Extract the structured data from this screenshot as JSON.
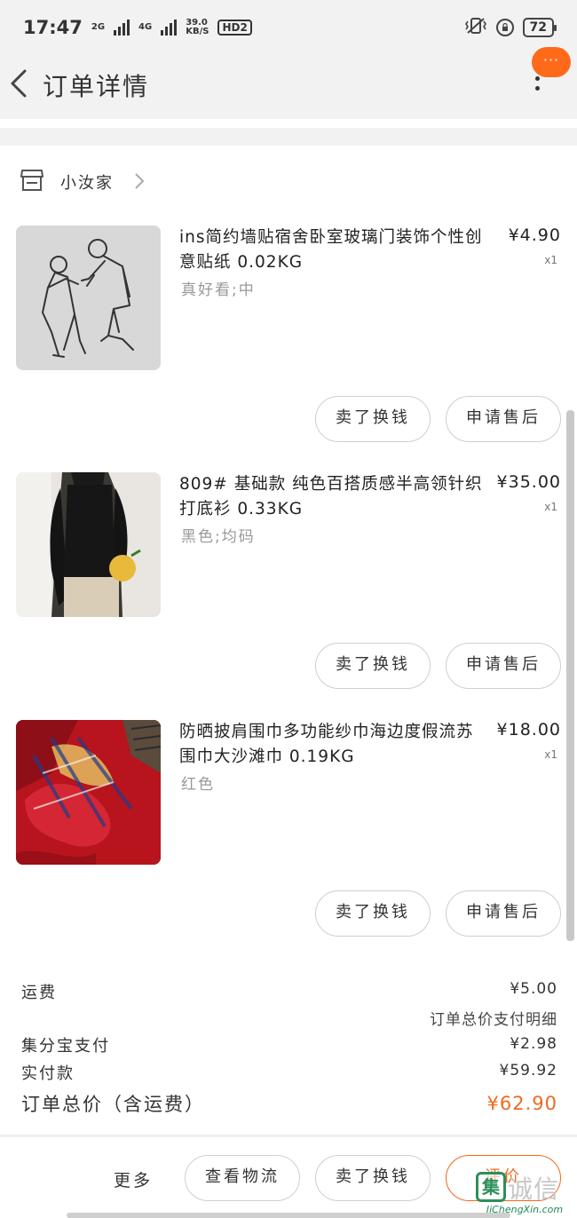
{
  "status_bar": {
    "time": "17:47",
    "net_2g": "2G",
    "net_4g": "4G",
    "speed_value": "39.0",
    "speed_unit": "KB/S",
    "hd": "HD2",
    "battery": "72"
  },
  "header": {
    "title": "订单详情",
    "chat_badge": "···"
  },
  "shop": {
    "name": "小汝家"
  },
  "products": [
    {
      "title": "ins简约墙贴宿舍卧室玻璃门装饰个性创意贴纸 0.02KG",
      "variant": "真好看;中",
      "price": "¥4.90",
      "qty": "x1",
      "btn_sell": "卖了换钱",
      "btn_aftersale": "申请售后"
    },
    {
      "title": "809# 基础款 纯色百搭质感半高领针织打底衫 0.33KG",
      "variant": "黑色;均码",
      "price": "¥35.00",
      "qty": "x1",
      "btn_sell": "卖了换钱",
      "btn_aftersale": "申请售后"
    },
    {
      "title": "防晒披肩围巾多功能纱巾海边度假流苏围巾大沙滩巾 0.19KG",
      "variant": "红色",
      "price": "¥18.00",
      "qty": "x1",
      "btn_sell": "卖了换钱",
      "btn_aftersale": "申请售后"
    }
  ],
  "summary": {
    "shipping_label": "运费",
    "shipping_value": "¥5.00",
    "payment_detail_link": "订单总价支付明细",
    "points_label": "集分宝支付",
    "points_value": "¥2.98",
    "paid_label": "实付款",
    "paid_value": "¥59.92",
    "total_label": "订单总价（含运费）",
    "total_value": "¥62.90"
  },
  "bottom_bar": {
    "more": "更多",
    "logistics": "查看物流",
    "sell": "卖了换钱",
    "review": "评价"
  },
  "watermark": {
    "mark": "集",
    "text": "诚信",
    "site": "JiChengXin.com"
  },
  "colors": {
    "accent": "#f06a1f",
    "header_bg": "#f2f2f2",
    "muted_text": "#999999"
  }
}
